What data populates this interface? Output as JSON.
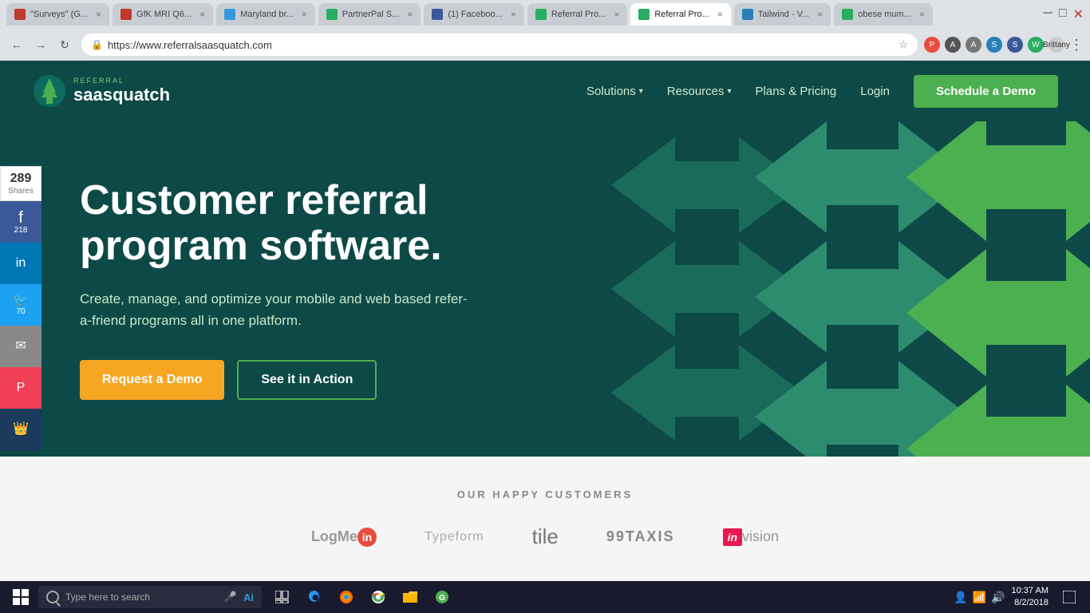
{
  "browser": {
    "tabs": [
      {
        "label": "\"Surveys\" (G...",
        "favicon_color": "#c0392b",
        "active": false
      },
      {
        "label": "GfK MRI Q6...",
        "favicon_color": "#c0392b",
        "active": false
      },
      {
        "label": "Maryland br...",
        "favicon_color": "#3498db",
        "active": false
      },
      {
        "label": "PartnerPal S...",
        "favicon_color": "#27ae60",
        "active": false
      },
      {
        "label": "(1) Faceboo...",
        "favicon_color": "#3b5998",
        "active": false
      },
      {
        "label": "Referral Pro...",
        "favicon_color": "#27ae60",
        "active": false
      },
      {
        "label": "Referral Pro...",
        "favicon_color": "#27ae60",
        "active": true
      },
      {
        "label": "Tailwind - V...",
        "favicon_color": "#2980b9",
        "active": false
      },
      {
        "label": "obese mum...",
        "favicon_color": "#27ae60",
        "active": false
      }
    ],
    "url": "https://www.referralsaasquatch.com",
    "user": "Brittany"
  },
  "social": {
    "count": "289",
    "label": "Shares",
    "facebook": "218",
    "twitter": "70"
  },
  "nav": {
    "logo_brand": "REFERRAL",
    "logo_name": "saasquatch",
    "solutions_label": "Solutions",
    "resources_label": "Resources",
    "plans_label": "Plans & Pricing",
    "login_label": "Login",
    "cta_label": "Schedule a Demo"
  },
  "hero": {
    "title": "Customer referral program software.",
    "description": "Create, manage, and optimize your mobile and web based refer-a-friend programs all in one platform.",
    "btn_demo": "Request a Demo",
    "btn_action": "See it in Action"
  },
  "customers": {
    "title": "OUR HAPPY CUSTOMERS",
    "logos": [
      "LogMeIn",
      "Typeform",
      "tile",
      "99TAXIS",
      "InVision"
    ]
  },
  "taskbar": {
    "search_placeholder": "Type here to search",
    "time": "10:37 AM",
    "date": "8/2/2018"
  }
}
